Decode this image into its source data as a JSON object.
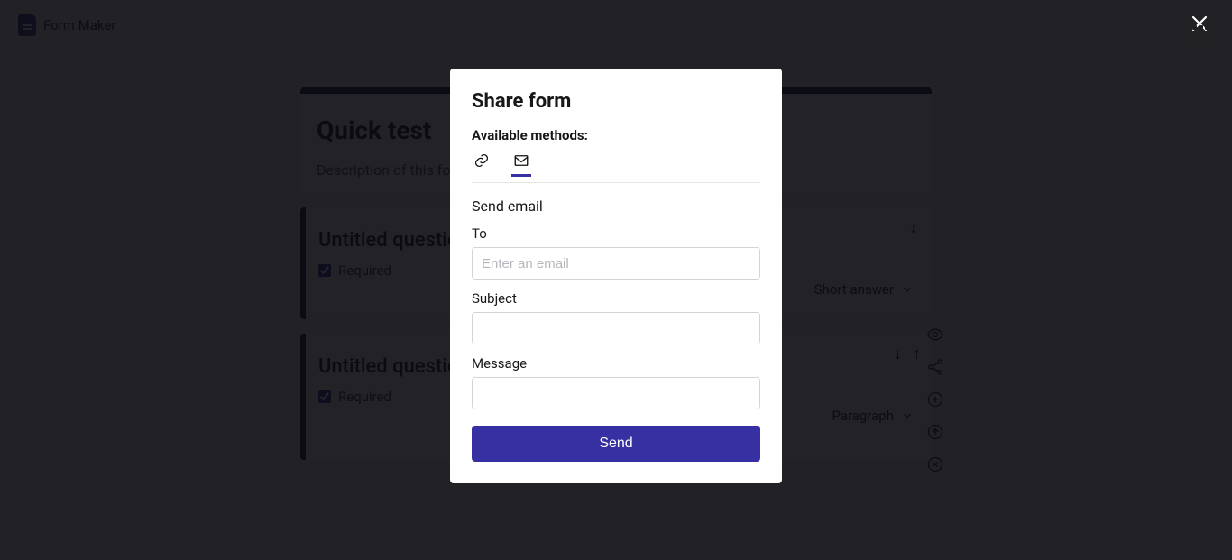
{
  "brand": {
    "name": "Form Maker"
  },
  "form": {
    "title": "Quick test",
    "description": "Description of this form"
  },
  "questions": [
    {
      "title": "Untitled question",
      "required_label": "Required",
      "required": true,
      "type_label": "Short answer"
    },
    {
      "title": "Untitled question",
      "required_label": "Required",
      "required": true,
      "type_label": "Paragraph"
    }
  ],
  "modal": {
    "title": "Share form",
    "methods_label": "Available methods:",
    "section_heading": "Send email",
    "to_label": "To",
    "to_placeholder": "Enter an email",
    "subject_label": "Subject",
    "subject_value": "",
    "message_label": "Message",
    "message_value": "",
    "send_label": "Send"
  }
}
